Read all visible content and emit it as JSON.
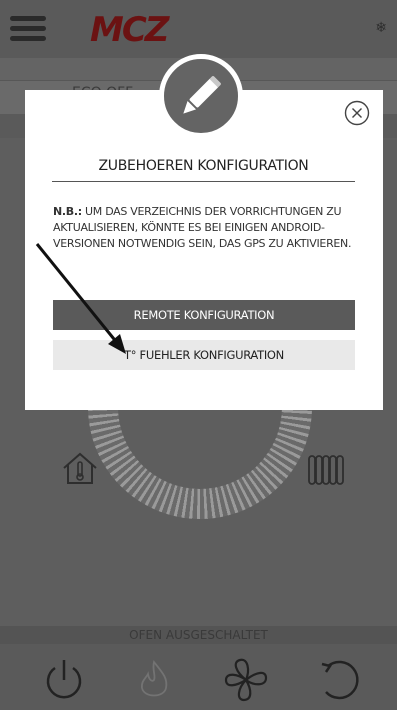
{
  "header": {
    "logo_text": "MCZ",
    "menu_icon": "hamburger-icon",
    "status_icon": "snowflake-icon"
  },
  "background": {
    "mode_label": "ECO OFF",
    "status_text": "OFEN AUSGESCHALTET",
    "left_icon": "house-thermometer-icon",
    "right_icon": "radiator-icon",
    "bottom_icons": [
      "power-icon",
      "flame-icon",
      "fan-icon",
      "reset-icon"
    ]
  },
  "modal": {
    "title": "ZUBEHOEREN KONFIGURATION",
    "note_prefix": "N.B.:",
    "note_text": " UM DAS VERZEICHNIS DER VORRICHTUNGEN ZU AKTUALISIEREN, KÖNNTE ES BEI EINIGEN ANDROID-VERSIONEN NOTWENDIG SEIN, DAS GPS ZU AKTIVIEREN.",
    "remote_button": "REMOTE KONFIGURATION",
    "probe_button": "T° FUEHLER KONFIGURATION",
    "badge_icon": "pencil-icon",
    "close_icon": "close-icon"
  },
  "colors": {
    "overlay": "#5e5e5e",
    "logo": "#6b1212",
    "primary_button": "#5a5a5a",
    "secondary_button": "#e9e9e9"
  }
}
